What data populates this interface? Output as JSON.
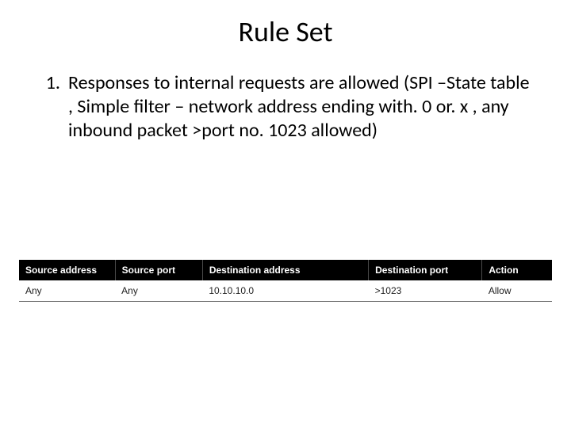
{
  "title": "Rule Set",
  "list": {
    "items": [
      {
        "num": "1.",
        "text": "Responses to internal requests are allowed (SPI –State table , Simple filter – network address ending with. 0 or. x , any inbound packet >port no. 1023 allowed)"
      }
    ]
  },
  "table": {
    "headers": {
      "source_address": "Source address",
      "source_port": "Source port",
      "destination_address": "Destination address",
      "destination_port": "Destination port",
      "action": "Action"
    },
    "rows": [
      {
        "source_address": "Any",
        "source_port": "Any",
        "destination_address": "10.10.10.0",
        "destination_port": ">1023",
        "action": "Allow"
      }
    ]
  }
}
